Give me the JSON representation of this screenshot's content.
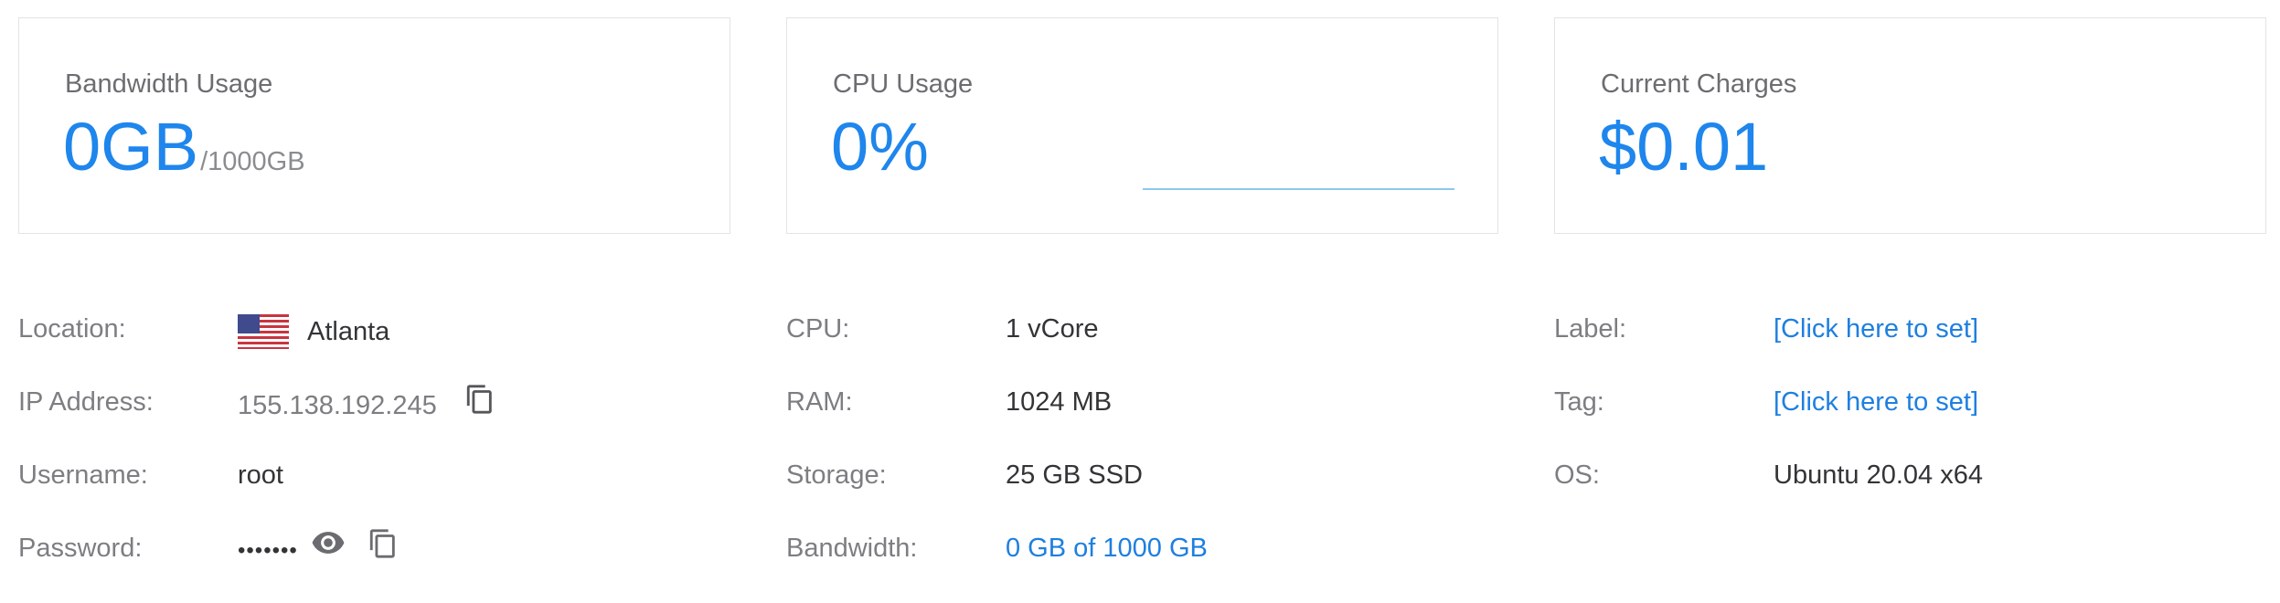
{
  "stats": {
    "bandwidth": {
      "title": "Bandwidth Usage",
      "value": "0GB",
      "suffix": "/1000GB"
    },
    "cpu": {
      "title": "CPU Usage",
      "value": "0%"
    },
    "charges": {
      "title": "Current Charges",
      "value": "$0.01"
    }
  },
  "server": {
    "location_label": "Location:",
    "location_value": "Atlanta",
    "ip_label": "IP Address:",
    "ip_value": "155.138.192.245",
    "username_label": "Username:",
    "username_value": "root",
    "password_label": "Password:",
    "password_value": "•••••••"
  },
  "specs": {
    "cpu_label": "CPU:",
    "cpu_value": "1 vCore",
    "ram_label": "RAM:",
    "ram_value": "1024 MB",
    "storage_label": "Storage:",
    "storage_value": "25 GB SSD",
    "bandwidth_label": "Bandwidth:",
    "bandwidth_value": "0 GB of 1000 GB"
  },
  "meta": {
    "label_label": "Label:",
    "label_value": "[Click here to set]",
    "tag_label": "Tag:",
    "tag_value": "[Click here to set]",
    "os_label": "OS:",
    "os_value": "Ubuntu 20.04 x64"
  },
  "icons": {
    "location": "us-flag-icon",
    "ip_copy": "copy-icon",
    "password_reveal": "eye-icon",
    "password_copy": "copy-icon"
  },
  "colors": {
    "accent": "#1e86ec",
    "link": "#1e7fe0",
    "border": "#e3e4e6",
    "sparkline": "#8ec8ec"
  }
}
